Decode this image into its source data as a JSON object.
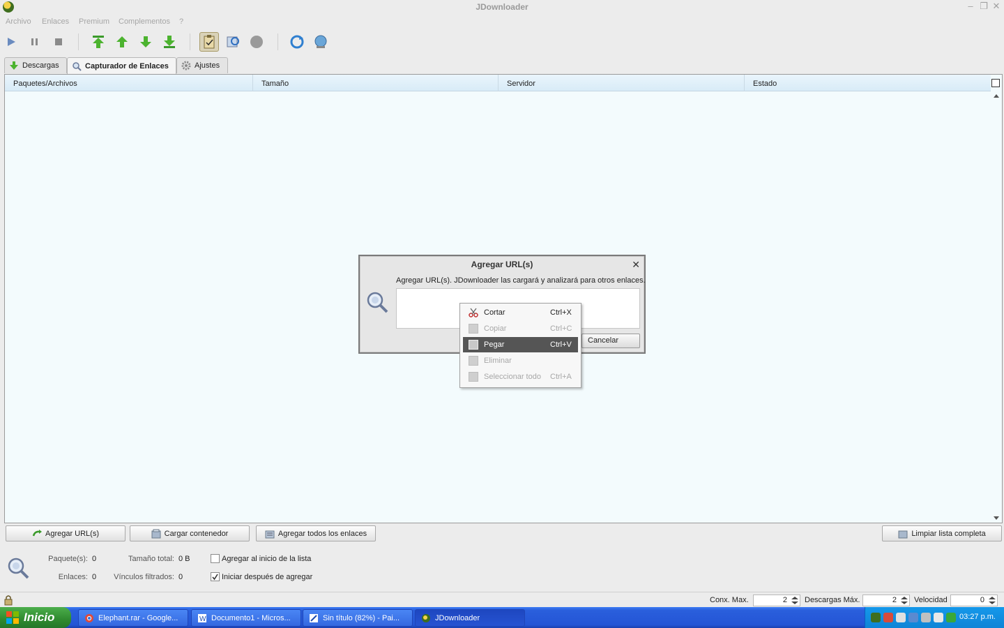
{
  "window": {
    "title": "JDownloader"
  },
  "menu": [
    "Archivo",
    "Enlaces",
    "Premium",
    "Complementos",
    "?"
  ],
  "tabs": [
    {
      "label": "Descargas",
      "icon": "download-arrow-icon"
    },
    {
      "label": "Capturador de Enlaces",
      "icon": "magnifier-icon"
    },
    {
      "label": "Ajustes",
      "icon": "gear-icon"
    }
  ],
  "table": {
    "columns": [
      "Paquetes/Archivos",
      "Tamaño",
      "Servidor",
      "Estado"
    ]
  },
  "dialog": {
    "title": "Agregar URL(s)",
    "description": "Agregar URL(s). JDownloader las cargará y analizará para otros enlaces.",
    "cancel_label": "Cancelar"
  },
  "context_menu": [
    {
      "label": "Cortar",
      "shortcut": "Ctrl+X",
      "enabled": true,
      "icon": "scissors-icon"
    },
    {
      "label": "Copiar",
      "shortcut": "Ctrl+C",
      "enabled": false,
      "icon": "copy-icon"
    },
    {
      "label": "Pegar",
      "shortcut": "Ctrl+V",
      "enabled": true,
      "highlighted": true,
      "icon": "paste-icon"
    },
    {
      "label": "Eliminar",
      "shortcut": "",
      "enabled": false,
      "icon": "delete-icon"
    },
    {
      "label": "Seleccionar todo",
      "shortcut": "Ctrl+A",
      "enabled": false,
      "icon": "select-all-icon"
    }
  ],
  "bottom_buttons": {
    "add_urls": "Agregar URL(s)",
    "load_container": "Cargar contenedor",
    "add_all": "Agregar todos los enlaces",
    "clear_list": "Limpiar lista completa"
  },
  "info": {
    "packages_label": "Paquete(s):",
    "packages_value": "0",
    "total_size_label": "Tamaño total:",
    "total_size_value": "0 B",
    "links_label": "Enlaces:",
    "links_value": "0",
    "filtered_label": "Vínculos filtrados:",
    "filtered_value": "0",
    "add_to_start_label": "Agregar al inicio de la lista",
    "add_to_start_checked": false,
    "start_after_add_label": "Iniciar después de agregar",
    "start_after_add_checked": true
  },
  "statusbar": {
    "max_conn_label": "Conx. Max.",
    "max_conn_value": "2",
    "max_downloads_label": "Descargas Máx.",
    "max_downloads_value": "2",
    "speed_label": "Velocidad",
    "speed_value": "0"
  },
  "taskbar": {
    "start_label": "Inicio",
    "tasks": [
      {
        "label": "Elephant.rar - Google...",
        "icon": "chrome-icon",
        "active": false
      },
      {
        "label": "Documento1 - Micros...",
        "icon": "word-icon",
        "active": false
      },
      {
        "label": "Sin título (82%) - Pai...",
        "icon": "paint-icon",
        "active": false
      },
      {
        "label": "JDownloader",
        "icon": "jdownloader-icon",
        "active": true
      }
    ],
    "clock": "03:27 p.m."
  }
}
